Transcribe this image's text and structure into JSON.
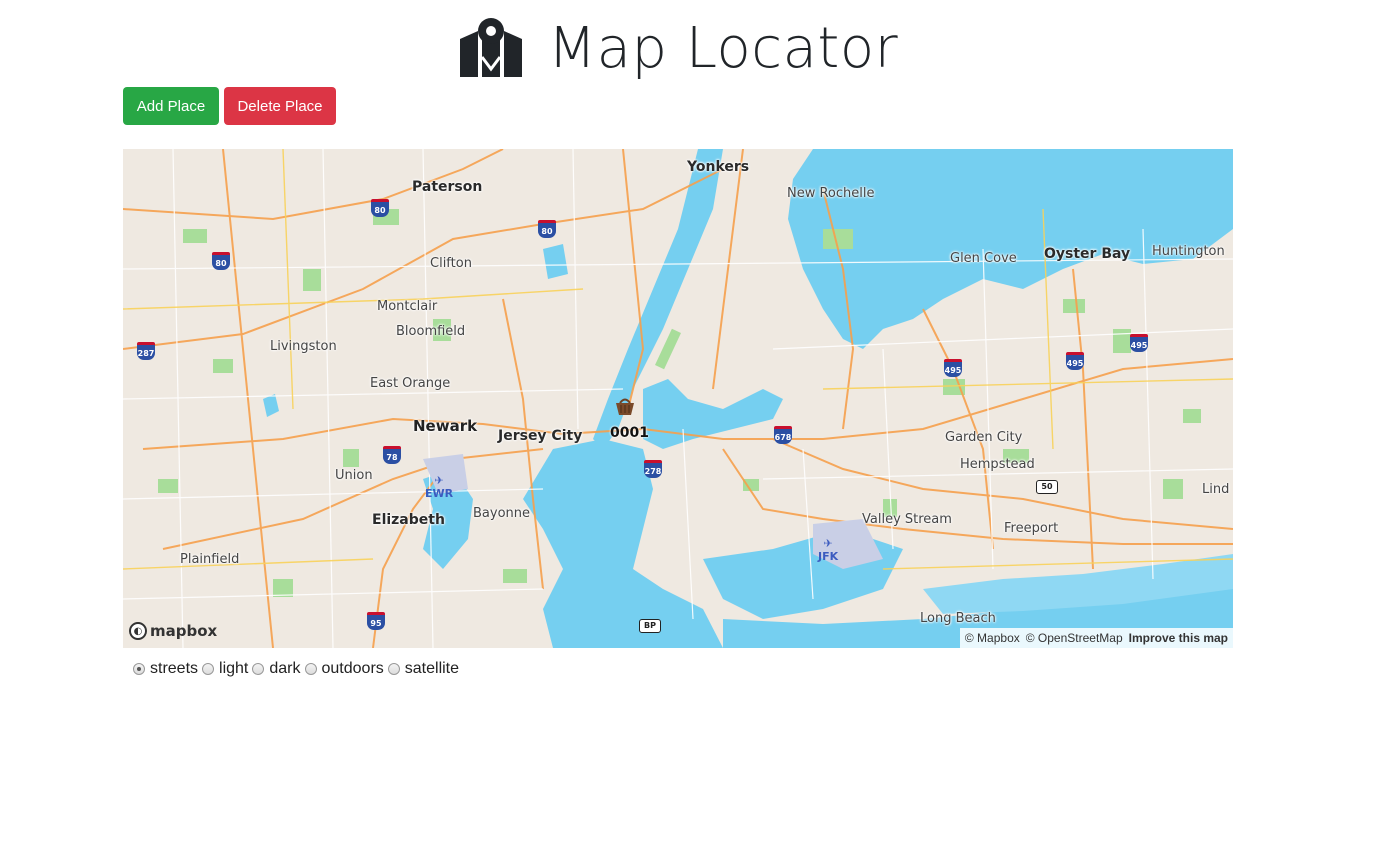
{
  "app": {
    "title": "Map Locator",
    "logo_icon": "map-marker-icon"
  },
  "toolbar": {
    "add_label": "Add Place",
    "delete_label": "Delete Place",
    "add_color": "#28a745",
    "delete_color": "#dc3545"
  },
  "map": {
    "places": [
      {
        "text": "Yonkers",
        "size": "med"
      },
      {
        "text": "Paterson",
        "size": "med"
      },
      {
        "text": "New Rochelle",
        "size": "sm"
      },
      {
        "text": "Clifton",
        "size": "sm"
      },
      {
        "text": "Glen Cove",
        "size": "sm"
      },
      {
        "text": "Oyster Bay",
        "size": "med"
      },
      {
        "text": "Huntington",
        "size": "sm"
      },
      {
        "text": "Montclair",
        "size": "sm"
      },
      {
        "text": "Bloomfield",
        "size": "sm"
      },
      {
        "text": "Livingston",
        "size": "sm"
      },
      {
        "text": "East Orange",
        "size": "sm"
      },
      {
        "text": "Newark",
        "size": "big"
      },
      {
        "text": "Jersey City",
        "size": "med"
      },
      {
        "text": "Garden City",
        "size": "sm"
      },
      {
        "text": "Hempstead",
        "size": "sm"
      },
      {
        "text": "Union",
        "size": "sm"
      },
      {
        "text": "Lind",
        "size": "sm"
      },
      {
        "text": "Elizabeth",
        "size": "med"
      },
      {
        "text": "Bayonne",
        "size": "sm"
      },
      {
        "text": "Valley Stream",
        "size": "sm"
      },
      {
        "text": "Freeport",
        "size": "sm"
      },
      {
        "text": "Plainfield",
        "size": "sm"
      },
      {
        "text": "Long Beach",
        "size": "sm"
      }
    ],
    "highways": [
      "80",
      "80",
      "80",
      "287",
      "495",
      "495",
      "495",
      "678",
      "78",
      "278",
      "95"
    ],
    "route_shields": [
      "50",
      "BP"
    ],
    "airports": [
      "EWR",
      "JFK"
    ],
    "marker": {
      "label": "0001",
      "icon": "basket-icon"
    },
    "logo_text": "mapbox",
    "attribution": {
      "mapbox": "© Mapbox",
      "osm": "© OpenStreetMap",
      "improve": "Improve this map"
    },
    "colors": {
      "land": "#efe9e1",
      "water": "#75cff0",
      "park": "#a8dd9a",
      "road": "#f6a04d"
    }
  },
  "styles": {
    "options": [
      "streets",
      "light",
      "dark",
      "outdoors",
      "satellite"
    ],
    "selected": "streets"
  }
}
